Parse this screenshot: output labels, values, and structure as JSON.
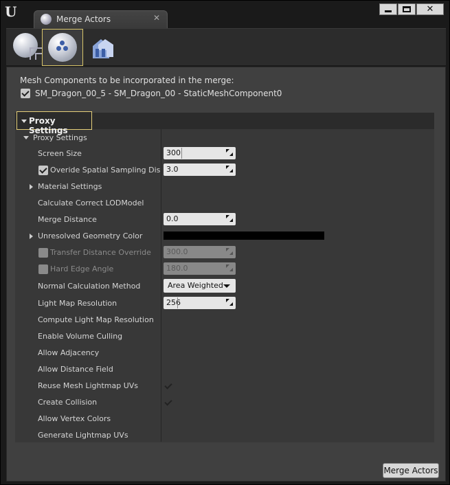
{
  "window": {
    "tab_title": "Merge Actors",
    "tab_close": "✕",
    "logo": "U"
  },
  "icons": {
    "logo": "unreal-logo-icon",
    "tab": "merge-actors-tab-icon",
    "tool1": "mesh-merge-icon",
    "tool2": "mesh-proxy-icon",
    "tool3": "mesh-instancing-icon"
  },
  "mesh_components": {
    "label": "Mesh Components to be incorporated in the merge:",
    "items": [
      {
        "text": "SM_Dragon_00_5 - SM_Dragon_00 - StaticMeshComponent0",
        "checked": true
      }
    ]
  },
  "proxy": {
    "category_title": "Proxy Settings",
    "subcategory_title": "Proxy Settings",
    "rows": {
      "screen_size": {
        "label": "Screen Size",
        "value": "300"
      },
      "spatial_sampling": {
        "label": "Overide Spatial Sampling Distance",
        "value": "3.0",
        "checked": true
      },
      "material_settings": {
        "label": "Material Settings"
      },
      "correct_lod": {
        "label": "Calculate Correct LODModel",
        "checked": false
      },
      "merge_distance": {
        "label": "Merge Distance",
        "value": "0.0"
      },
      "unresolved_color": {
        "label": "Unresolved Geometry Color",
        "color": "#000000"
      },
      "transfer_distance": {
        "label": "Transfer Distance Override",
        "value": "300.0",
        "checked": false
      },
      "hard_edge": {
        "label": "Hard Edge Angle",
        "value": "180.0",
        "checked": false
      },
      "normal_method": {
        "label": "Normal Calculation Method",
        "value": "Area  Weighted"
      },
      "light_map_res": {
        "label": "Light Map Resolution",
        "value": "256"
      },
      "compute_lm_res": {
        "label": "Compute Light Map Resolution",
        "checked": false
      },
      "volume_culling": {
        "label": "Enable Volume Culling",
        "checked": false
      },
      "adjacency": {
        "label": "Allow Adjacency",
        "checked": false
      },
      "distance_field": {
        "label": "Allow Distance Field",
        "checked": false
      },
      "reuse_lm_uvs": {
        "label": "Reuse Mesh Lightmap UVs",
        "checked": true
      },
      "collision": {
        "label": "Create Collision",
        "checked": true
      },
      "vertex_colors": {
        "label": "Allow Vertex Colors",
        "checked": false
      },
      "gen_lm_uvs": {
        "label": "Generate Lightmap UVs",
        "checked": false
      }
    }
  },
  "actions": {
    "merge_label": "Merge Actors"
  },
  "colors": {
    "highlight": "#e6d07a",
    "panel": "#404040",
    "details": "#383838"
  }
}
